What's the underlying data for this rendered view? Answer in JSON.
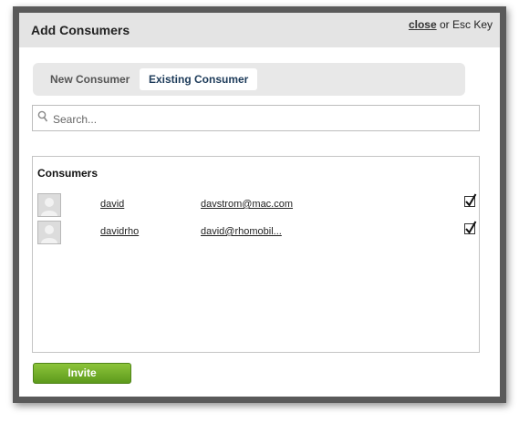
{
  "dialog": {
    "title": "Add Consumers",
    "close_link": "close",
    "close_hint": " or Esc Key"
  },
  "tabs": [
    {
      "label": "New Consumer",
      "active": false
    },
    {
      "label": "Existing Consumer",
      "active": true
    }
  ],
  "search": {
    "placeholder": "Search...",
    "value": ""
  },
  "consumers": {
    "heading": "Consumers",
    "rows": [
      {
        "name": "david",
        "email": "davstrom@mac.com",
        "checked": true
      },
      {
        "name": "davidrho",
        "email": "david@rhomobil...",
        "checked": true
      }
    ]
  },
  "actions": {
    "invite_label": "Invite"
  },
  "colors": {
    "accent_green": "#6fac27",
    "header_bg": "#e4e4e4",
    "frame": "#5a5a5a"
  }
}
